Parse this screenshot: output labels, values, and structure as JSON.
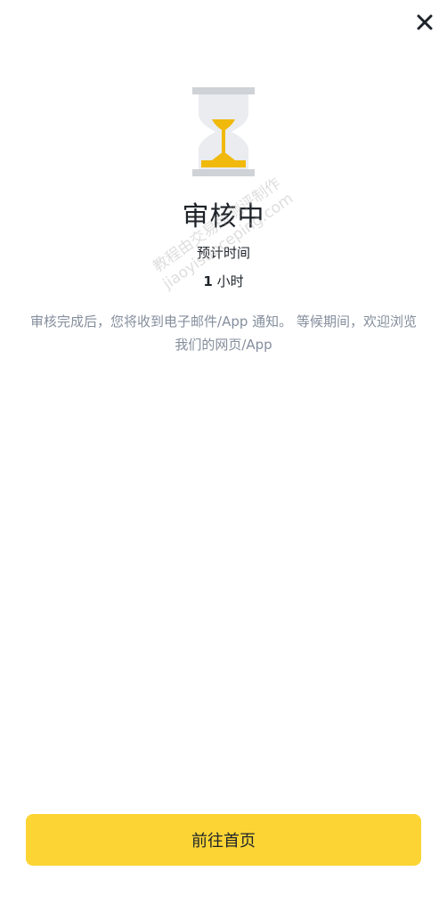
{
  "header": {
    "close_icon": "close-icon"
  },
  "status": {
    "icon": "hourglass-icon",
    "title": "审核中",
    "estimate_label": "预计时间",
    "estimate_number": "1",
    "estimate_unit": " 小时",
    "description": "审核完成后，您将收到电子邮件/App 通知。 等候期间，欢迎浏览我们的网页/App"
  },
  "watermark": {
    "line1": "教程由交易所测评制作",
    "line2": "jiaoyisuoceping.com"
  },
  "footer": {
    "home_button_label": "前往首页"
  },
  "colors": {
    "accent": "#fcd535",
    "hourglass_sand": "#f0b90b",
    "hourglass_frame": "#cfd2d6",
    "hourglass_glass": "#eaecef",
    "text_primary": "#1e2329",
    "text_secondary": "#848e9c"
  }
}
